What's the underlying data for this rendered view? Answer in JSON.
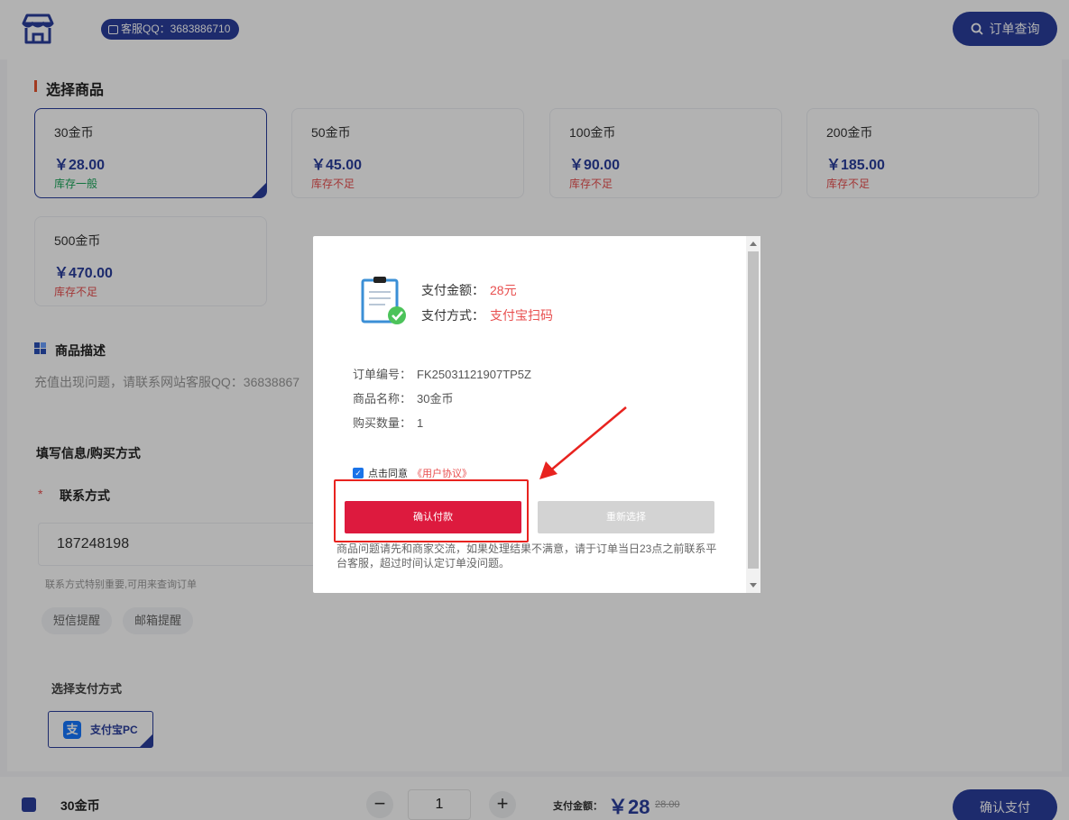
{
  "header": {
    "qq_badge": "客服QQ：3683886710",
    "order_query": "订单查询"
  },
  "goods_section": {
    "title": "选择商品",
    "items": [
      {
        "name": "30金币",
        "price": "￥28.00",
        "stock": "库存一般",
        "selected": true
      },
      {
        "name": "50金币",
        "price": "￥45.00",
        "stock": "库存不足",
        "selected": false
      },
      {
        "name": "100金币",
        "price": "￥90.00",
        "stock": "库存不足",
        "selected": false
      },
      {
        "name": "200金币",
        "price": "￥185.00",
        "stock": "库存不足",
        "selected": false
      },
      {
        "name": "500金币",
        "price": "￥470.00",
        "stock": "库存不足",
        "selected": false
      }
    ]
  },
  "description": {
    "title": "商品描述",
    "text": "充值出现问题，请联系网站客服QQ：36838867"
  },
  "form": {
    "title": "填写信息/购买方式",
    "contact_label": "联系方式",
    "required_mark": "*",
    "contact_value": "187248198",
    "contact_hint": "联系方式特别重要,可用来查询订单",
    "reminders": [
      "短信提醒",
      "邮箱提醒"
    ],
    "pay_title": "选择支付方式",
    "pay_method": "支付宝PC"
  },
  "bottom_bar": {
    "product": "30金币",
    "minus": "−",
    "quantity": "1",
    "plus": "+",
    "pay_label": "支付金额：",
    "price": "￥28",
    "old_price": "28.00",
    "confirm": "确认支付"
  },
  "modal": {
    "amount_label": "支付金额：",
    "amount_value": "28元",
    "method_label": "支付方式：",
    "method_value": "支付宝扫码",
    "order_no_label": "订单编号：",
    "order_no": "FK25031121907TP5Z",
    "product_label": "商品名称：",
    "product": "30金币",
    "qty_label": "购买数量：",
    "qty": "1",
    "agree_text": "点击同意",
    "agree_link": "《用户协议》",
    "confirm_button": "确认付款",
    "reselect_button": "重新选择",
    "note": "商品问题请先和商家交流，如果处理结果不满意，请于订单当日23点之前联系平台客服，超过时间认定订单没问题。"
  },
  "colors": {
    "brand": "#2a3e9c",
    "danger": "#dd1a3e",
    "annotation": "#e8231f"
  }
}
